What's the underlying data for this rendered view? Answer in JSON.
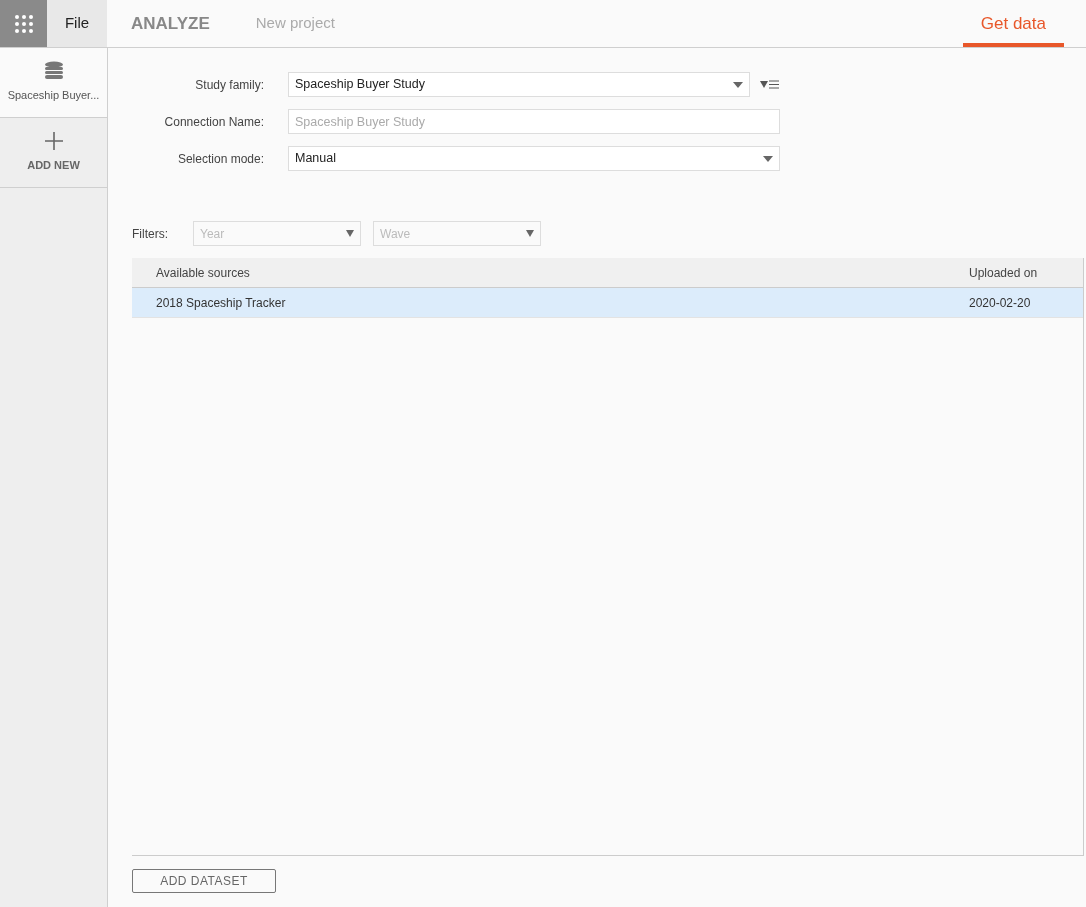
{
  "header": {
    "menu": "File",
    "app_title": "ANALYZE",
    "project": "New project",
    "tabs": [
      {
        "label": "Get data",
        "selected": true
      }
    ]
  },
  "sidebar": {
    "items": [
      {
        "kind": "dataset",
        "label": "Spaceship Buyer...",
        "selected": true
      },
      {
        "kind": "add",
        "label": "ADD NEW",
        "selected": false
      }
    ]
  },
  "form": {
    "fields": [
      {
        "kind": "dropdown",
        "label": "Study family:",
        "value": "Spaceship Buyer Study",
        "filter_button": true
      },
      {
        "kind": "text",
        "label": "Connection Name:",
        "placeholder": "Spaceship Buyer Study",
        "filter_button": false
      },
      {
        "kind": "dropdown",
        "label": "Selection mode:",
        "value": "Manual",
        "filter_button": false
      }
    ]
  },
  "filters": {
    "label": "Filters:",
    "dropdowns": [
      {
        "placeholder": "Year"
      },
      {
        "placeholder": "Wave"
      }
    ]
  },
  "table": {
    "columns": [
      "Available sources",
      "Uploaded on"
    ],
    "rows": [
      {
        "cells": [
          "2018 Spaceship Tracker",
          "2020-02-20"
        ],
        "selected": true
      }
    ]
  },
  "footer": {
    "button": "ADD DATASET"
  }
}
